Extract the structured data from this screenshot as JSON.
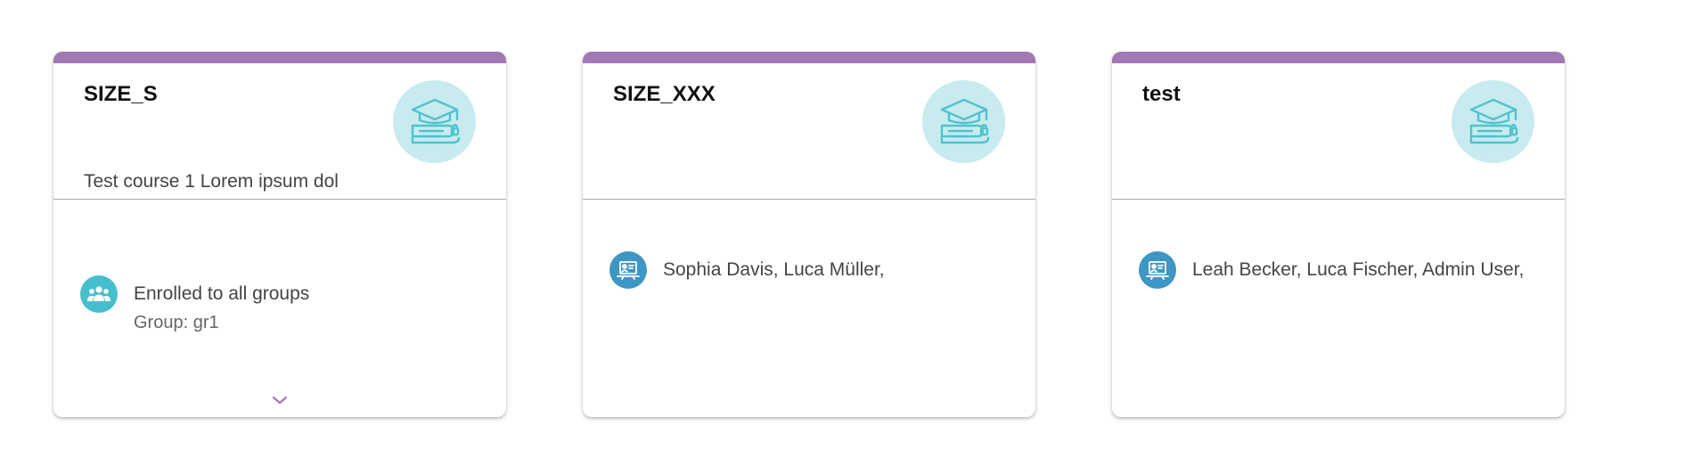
{
  "colors": {
    "accent": "#a178b5",
    "badge_bg": "#c7ebee",
    "groups_icon_bg": "#46bfcc",
    "teachers_icon_bg": "#3d96c4"
  },
  "cards": [
    {
      "title": "SIZE_S",
      "description": "Test course 1 Lorem ipsum dol",
      "icon": "graduation-cap-icon",
      "enrollment": {
        "icon": "users-group-icon",
        "label": "Enrolled to all groups",
        "group": "Group: gr1"
      },
      "expand_icon": "chevron-down-icon"
    },
    {
      "title": "SIZE_XXX",
      "description": "",
      "icon": "graduation-cap-icon",
      "teachers": {
        "icon": "teacher-icon",
        "names": "Sophia Davis, Luca Müller,"
      }
    },
    {
      "title": "test",
      "description": "",
      "icon": "graduation-cap-icon",
      "teachers": {
        "icon": "teacher-icon",
        "names": "Leah Becker, Luca Fischer, Admin User,"
      }
    }
  ]
}
